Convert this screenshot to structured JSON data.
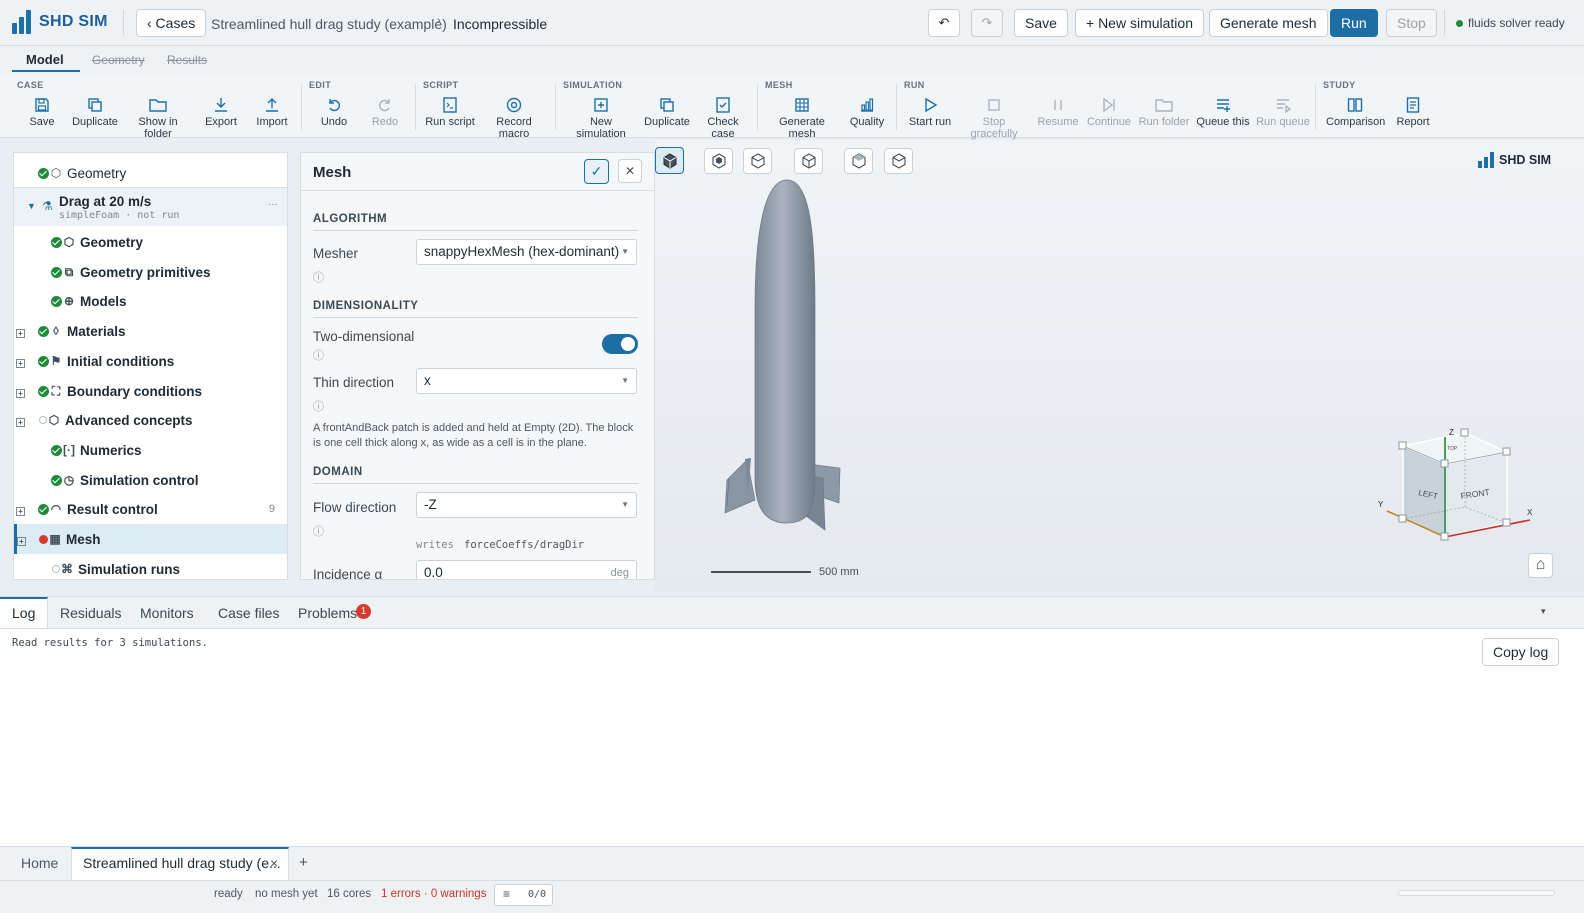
{
  "app": {
    "name": "SHD SIM"
  },
  "topbar": {
    "back_label": "‹ Cases",
    "breadcrumb_project": "Streamlined hull drag study (example)",
    "breadcrumb_sep": "›",
    "breadcrumb_current": "Incompressible",
    "undo_icon": "↶",
    "redo_icon": "↷",
    "save": "Save",
    "new_simulation": "+ New simulation",
    "generate_mesh": "Generate mesh",
    "run": "Run",
    "stop": "Stop",
    "status": "fluids solver ready",
    "status_color": "#1f8a3a"
  },
  "mode_tabs": [
    "Model",
    "Geometry",
    "Results"
  ],
  "ribbon": {
    "groups": [
      "CASE",
      "EDIT",
      "SCRIPT",
      "SIMULATION",
      "MESH",
      "RUN",
      "STUDY"
    ],
    "buttons": [
      "Save",
      "Duplicate",
      "Show in folder",
      "Export",
      "Import",
      "Undo",
      "Redo",
      "Run script",
      "Record macro",
      "New simulation",
      "Duplicate",
      "Check case",
      "Generate mesh",
      "Quality",
      "Start run",
      "Stop gracefully",
      "Resume",
      "Continue",
      "Run folder",
      "Queue this",
      "Run queue",
      "Comparison",
      "Report"
    ]
  },
  "tree": {
    "top_geometry": "Geometry",
    "sim_name": "Drag at 20 m/s",
    "sim_sub": "simpleFoam · not run",
    "sim_menu": "···",
    "items": [
      "Geometry",
      "Geometry primitives",
      "Models",
      "Materials",
      "Initial conditions",
      "Boundary conditions",
      "Advanced concepts",
      "Numerics",
      "Simulation control",
      "Result control",
      "Mesh",
      "Simulation runs"
    ],
    "result_control_count": "9"
  },
  "mesh_panel": {
    "title": "Mesh",
    "confirm_icon": "✓",
    "close_icon": "✕",
    "algorithm": "ALGORITHM",
    "mesher_label": "Mesher",
    "mesher_value": "snappyHexMesh (hex-dominant)",
    "dimensionality": "DIMENSIONALITY",
    "two_dim_label": "Two-dimensional",
    "two_dim_on": true,
    "thin_dir_label": "Thin direction",
    "thin_dir_value": "x",
    "note": "A frontAndBack patch is added and held at Empty (2D). The block is one cell thick along x, as wide as a cell is in the plane.",
    "domain": "DOMAIN",
    "flow_dir_label": "Flow direction",
    "flow_dir_value": "-Z",
    "writes_label": "writes",
    "writes_value": "forceCoeffs/dragDir",
    "incidence_label": "Incidence α",
    "incidence_value": "0.0",
    "incidence_unit": "deg",
    "info_icon": "ⓘ"
  },
  "viewport": {
    "brand": "SHD SIM",
    "scale_label": "500 mm",
    "gizmo": {
      "z": "Z",
      "y": "Y",
      "x": "X",
      "left": "LEFT",
      "front": "FRONT",
      "top": "TOP"
    },
    "home_icon": "⌂"
  },
  "log": {
    "tabs": [
      "Log",
      "Residuals",
      "Monitors",
      "Case files",
      "Problems"
    ],
    "problems_count": "1",
    "collapse_icon": "▾",
    "text": "Read results for 3 simulations.",
    "copy": "Copy log"
  },
  "doc_tabs": {
    "home": "Home",
    "current": "Streamlined hull drag study (e...",
    "close": "×",
    "add": "+"
  },
  "status": {
    "state": "ready",
    "mesh": "no mesh yet",
    "cores": "16 cores",
    "problems": "1 errors · 0 warnings",
    "queue": "0/0"
  }
}
